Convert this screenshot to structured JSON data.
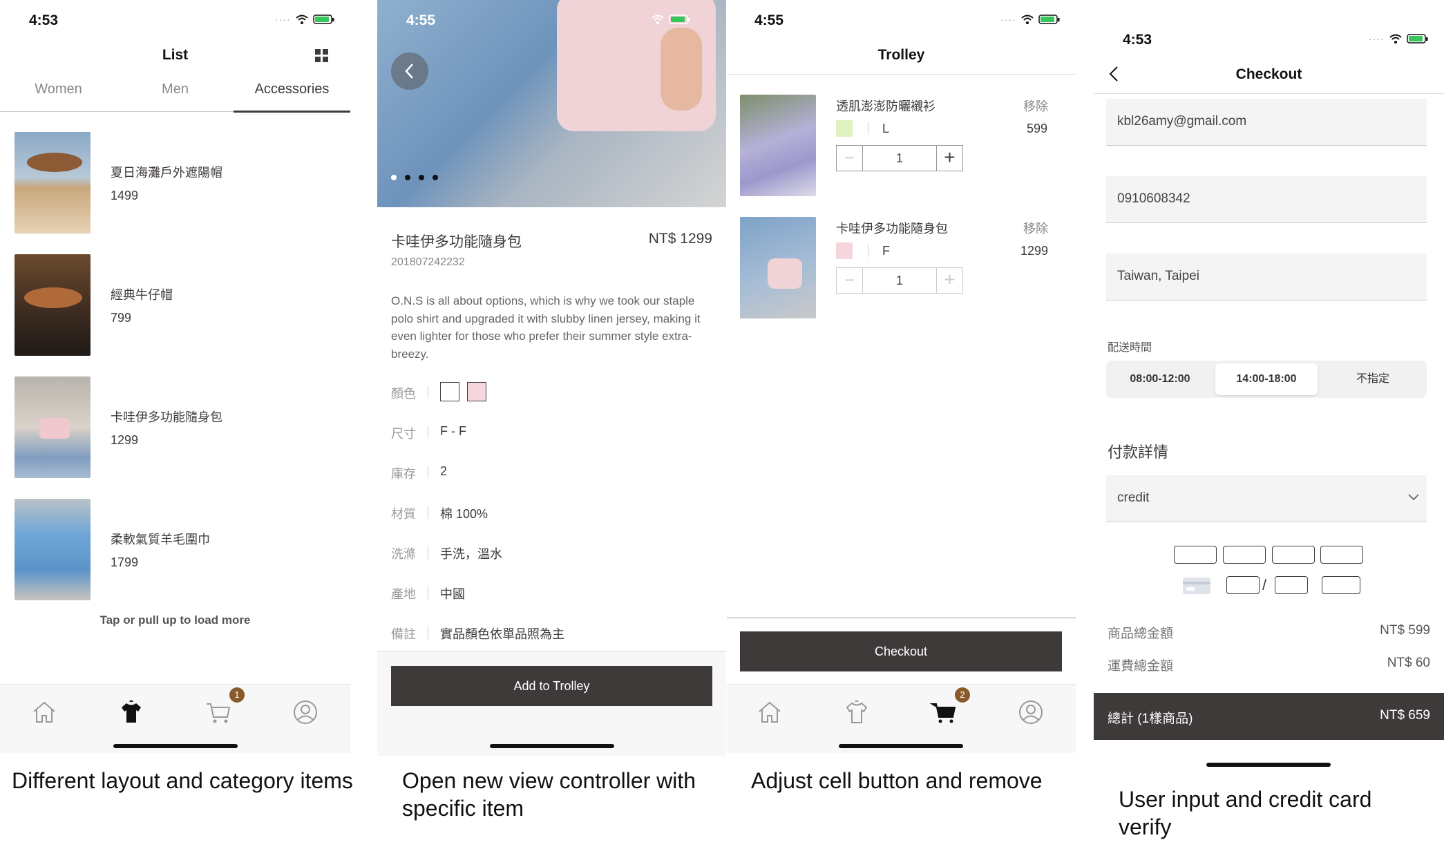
{
  "screens": {
    "list": {
      "time": "4:53",
      "title": "List",
      "tabs": [
        "Women",
        "Men",
        "Accessories"
      ],
      "active_tab": "Accessories",
      "products": [
        {
          "name": "夏日海灘戶外遮陽帽",
          "price": "1499"
        },
        {
          "name": "經典牛仔帽",
          "price": "799"
        },
        {
          "name": "卡哇伊多功能隨身包",
          "price": "1299"
        },
        {
          "name": "柔軟氣質羊毛圍巾",
          "price": "1799"
        }
      ],
      "load_more": "Tap or pull up to load more",
      "cart_badge": "1",
      "caption": "Different layout and category items"
    },
    "detail": {
      "time": "4:55",
      "name": "卡哇伊多功能隨身包",
      "price": "NT$ 1299",
      "sku": "201807242232",
      "description": "O.N.S is all about options, which is why we took our staple polo shirt and upgraded it with slubby linen jersey, making it even lighter for those who prefer their summer style extra-breezy.",
      "attrs": {
        "color_label": "顏色",
        "size_label": "尺寸",
        "size": "F - F",
        "stock_label": "庫存",
        "stock": "2",
        "texture_label": "材質",
        "texture": "棉 100%",
        "wash_label": "洗滌",
        "wash": "手洗，溫水",
        "place_label": "產地",
        "place": "中國",
        "note_label": "備註",
        "note": "實品顏色依單品照為主"
      },
      "colors": [
        "#ffffff",
        "#f5d6dc"
      ],
      "add_button": "Add to Trolley",
      "caption": "Open new view controller with specific item"
    },
    "trolley": {
      "time": "4:55",
      "title": "Trolley",
      "items": [
        {
          "name": "透肌澎澎防曬襯衫",
          "remove": "移除",
          "size": "L",
          "price": "599",
          "qty": "1",
          "color": "#dff2c0"
        },
        {
          "name": "卡哇伊多功能隨身包",
          "remove": "移除",
          "size": "F",
          "price": "1299",
          "qty": "1",
          "color": "#f5d6dc"
        }
      ],
      "checkout_button": "Checkout",
      "cart_badge": "2",
      "caption": "Adjust cell button and remove"
    },
    "checkout": {
      "time": "4:53",
      "title": "Checkout",
      "email": "kbl26amy@gmail.com",
      "phone": "0910608342",
      "address": "Taiwan, Taipei",
      "delivery_label": "配送時間",
      "delivery_options": [
        "08:00-12:00",
        "14:00-18:00",
        "不指定"
      ],
      "delivery_selected": "14:00-18:00",
      "payment_label": "付款詳情",
      "payment_method": "credit",
      "subtotal_label": "商品總金額",
      "subtotal": "NT$ 599",
      "shipping_label": "運費總金額",
      "shipping": "NT$ 60",
      "total_label": "總計 (1樣商品)",
      "total": "NT$ 659",
      "caption": "User input and credit card verify"
    }
  }
}
